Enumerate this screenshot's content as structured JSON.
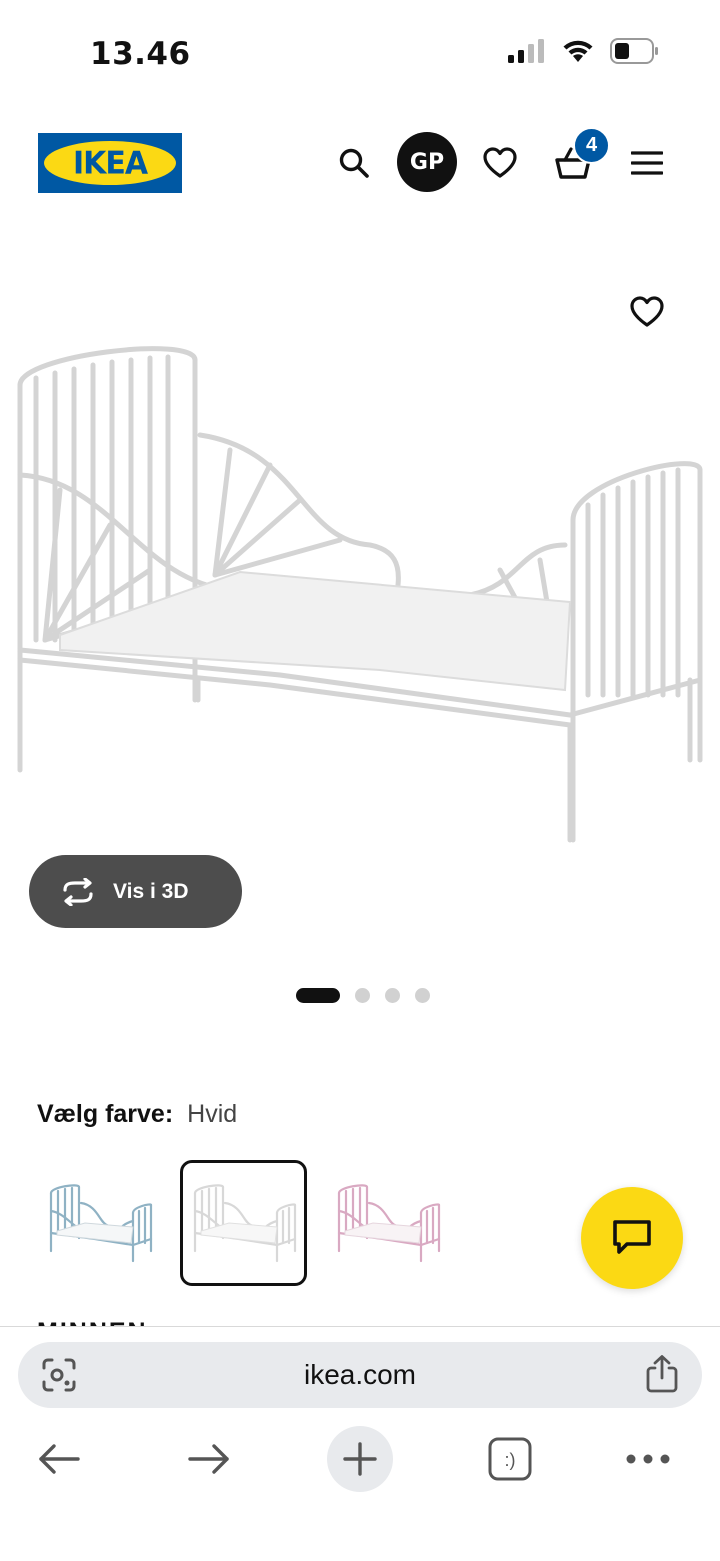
{
  "status_bar": {
    "time": "13.46",
    "icons": [
      "cellular-signal-icon",
      "wifi-icon",
      "battery-icon"
    ]
  },
  "header": {
    "logo_text": "IKEA",
    "avatar_initials": "GP",
    "cart_count": "4",
    "icons": [
      "search-icon",
      "heart-icon",
      "cart-icon",
      "menu-icon"
    ]
  },
  "product": {
    "view_3d_label": "Vis i 3D",
    "carousel": {
      "total": 4,
      "active_index": 0
    }
  },
  "color_selector": {
    "label": "Vælg farve:",
    "selected_value": "Hvid",
    "swatches": [
      "light-blue-bed",
      "white-bed",
      "pink-bed"
    ],
    "selected_index": 1
  },
  "peek_title": "MINNEN",
  "browser": {
    "url": "ikea.com",
    "icons": [
      "lens-icon",
      "share-icon",
      "back-arrow-icon",
      "forward-arrow-icon",
      "plus-icon",
      "tabs-icon",
      "more-icon"
    ],
    "tabs_glyph": ":)"
  },
  "colors": {
    "ikea_blue": "#0058a3",
    "ikea_yellow": "#fbd914",
    "button_dark": "#4d4d4d"
  }
}
